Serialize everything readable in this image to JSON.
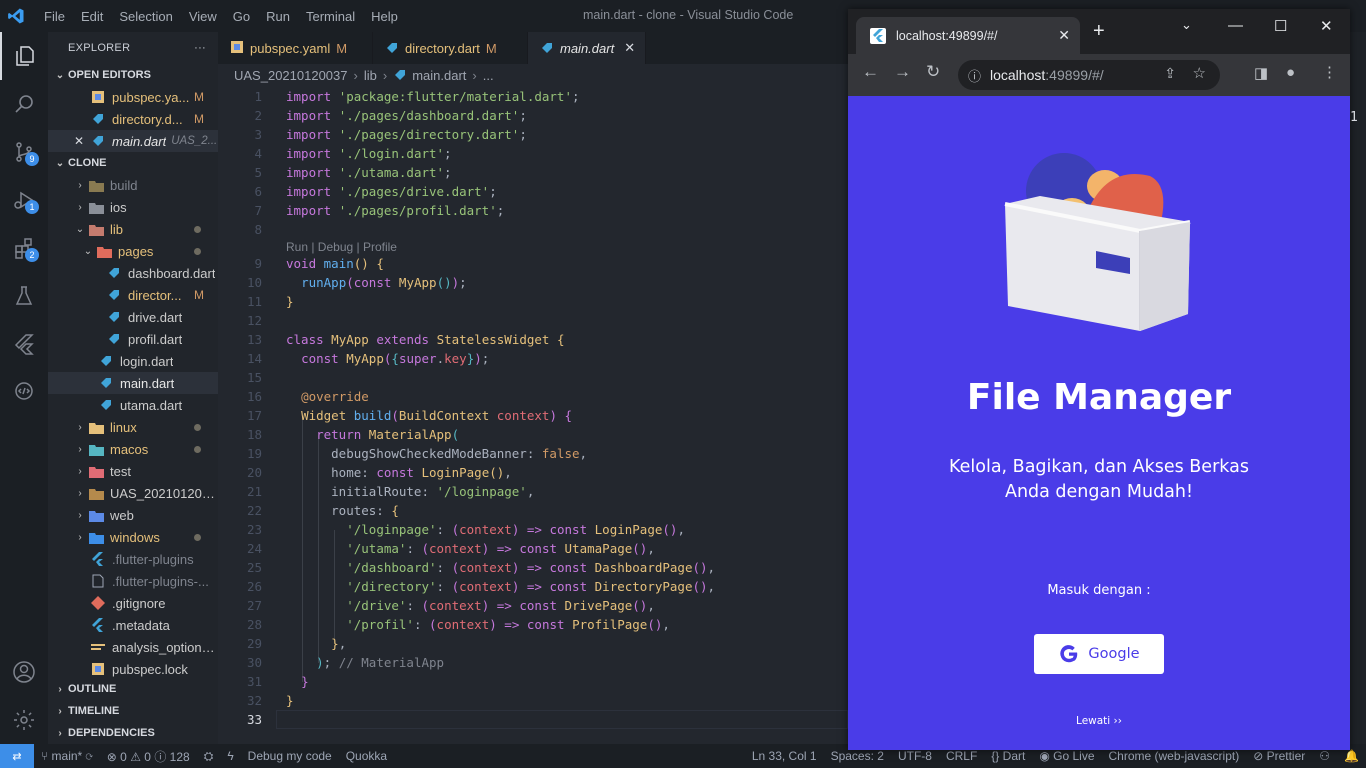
{
  "window": {
    "title": "main.dart - clone - Visual Studio Code",
    "menu": [
      "File",
      "Edit",
      "Selection",
      "View",
      "Go",
      "Run",
      "Terminal",
      "Help"
    ]
  },
  "activity": {
    "scm_badge": "9",
    "debug_badge": "1",
    "extensions_badge": "2"
  },
  "sidebar": {
    "header": "EXPLORER",
    "more": "···",
    "open_editors_title": "OPEN EDITORS",
    "open_editors": [
      {
        "name": "pubspec.ya...",
        "status": "M"
      },
      {
        "name": "directory.d...",
        "status": "M"
      },
      {
        "name": "main.dart",
        "detail": "UAS_2..."
      }
    ],
    "project_title": "CLONE",
    "tree": [
      {
        "name": "build"
      },
      {
        "name": "ios"
      },
      {
        "name": "lib"
      },
      {
        "name": "pages"
      },
      {
        "name": "dashboard.dart"
      },
      {
        "name": "director...",
        "status": "M"
      },
      {
        "name": "drive.dart"
      },
      {
        "name": "profil.dart"
      },
      {
        "name": "login.dart"
      },
      {
        "name": "main.dart"
      },
      {
        "name": "utama.dart"
      },
      {
        "name": "linux"
      },
      {
        "name": "macos"
      },
      {
        "name": "test"
      },
      {
        "name": "UAS_202101200..."
      },
      {
        "name": "web"
      },
      {
        "name": "windows"
      },
      {
        "name": ".flutter-plugins"
      },
      {
        "name": ".flutter-plugins-..."
      },
      {
        "name": ".gitignore"
      },
      {
        "name": ".metadata"
      },
      {
        "name": "analysis_options...."
      },
      {
        "name": "pubspec.lock"
      }
    ],
    "outline": "OUTLINE",
    "timeline": "TIMELINE",
    "dependencies": "DEPENDENCIES"
  },
  "tabs": [
    {
      "label": "pubspec.yaml",
      "status": "M"
    },
    {
      "label": "directory.dart",
      "status": "M"
    },
    {
      "label": "main.dart",
      "close": "✕"
    }
  ],
  "breadcrumb": [
    "UAS_20210120037",
    "lib",
    "main.dart",
    "..."
  ],
  "editor": {
    "codelens": "Run | Debug | Profile",
    "line_numbers": [
      "1",
      "2",
      "3",
      "4",
      "5",
      "6",
      "7",
      "8",
      "9",
      "10",
      "11",
      "12",
      "13",
      "14",
      "15",
      "16",
      "17",
      "18",
      "19",
      "20",
      "21",
      "22",
      "23",
      "24",
      "25",
      "26",
      "27",
      "28",
      "29",
      "30",
      "31",
      "32",
      "33"
    ],
    "comment_material": "// MaterialApp"
  },
  "status": {
    "branch": "main*",
    "errors": "0",
    "warnings": "0",
    "info": "128",
    "debug": "Debug my code",
    "quokka": "Quokka",
    "position": "Ln 33, Col 1",
    "spaces": "Spaces: 2",
    "encoding": "UTF-8",
    "eol": "CRLF",
    "language": "Dart",
    "golive": "Go Live",
    "device": "Chrome (web-javascript)",
    "prettier": "Prettier"
  },
  "browser": {
    "tab_title": "localhost:49899/#/",
    "url_host": "localhost",
    "url_path": ":49899/#/",
    "new_tab": "+"
  },
  "app": {
    "title": "File Manager",
    "subtitle": "Kelola, Bagikan, dan Akses Berkas Anda dengan Mudah!",
    "login_with": "Masuk dengan :",
    "google_button": "Google",
    "skip": "Lewati ››",
    "brand_color": "#4a3ce8"
  }
}
